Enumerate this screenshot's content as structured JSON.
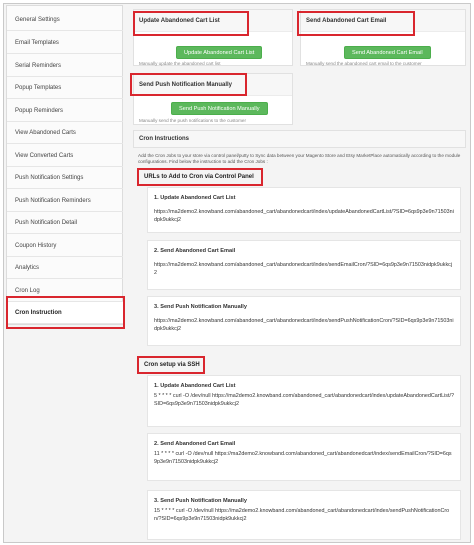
{
  "sidebar": {
    "items": [
      {
        "label": "General Settings"
      },
      {
        "label": "Email Templates"
      },
      {
        "label": "Serial Reminders"
      },
      {
        "label": "Popup Templates"
      },
      {
        "label": "Popup Reminders"
      },
      {
        "label": "View Abandoned Carts"
      },
      {
        "label": "View Converted Carts"
      },
      {
        "label": "Push Notification Settings"
      },
      {
        "label": "Push Notification Reminders"
      },
      {
        "label": "Push Notification Detail"
      },
      {
        "label": "Coupon History"
      },
      {
        "label": "Analytics"
      },
      {
        "label": "Cron Log"
      },
      {
        "label": "Cron Instruction"
      }
    ],
    "active_index": 13
  },
  "cards": {
    "update_cart": {
      "title": "Update Abandoned Cart List",
      "button": "Update Abandoned Cart List",
      "hint": "Manually update the abandoned cart list"
    },
    "send_email": {
      "title": "Send Abandoned Cart Email",
      "button": "Send Abandoned Cart Email",
      "hint": "Manually send the abandoned cart email to the customer"
    },
    "push": {
      "title": "Send Push Notification Manually",
      "button": "Send Push Notification Manually",
      "hint": "Manually send the push notifications to the customer"
    }
  },
  "instructions": {
    "title": "Cron Instructions",
    "text": "Add the Cron Jobs to your store via control panel/putty to Sync data between your Magento Store and Etsy MarketPlace automatically according to the module configurations. Find below the instruction to add the Cron Jobs :"
  },
  "urls_section": {
    "title": "URLs to Add to Cron via Control Panel",
    "items": [
      {
        "title": "1. Update Abandoned Cart List",
        "value": "https://ma2demo2.knowband.com/abandoned_cart/abandonedcart/index/updateAbandonedCartList/?SID=6qs9p3e9n71503nidpk9ukkcj2"
      },
      {
        "title": "2. Send Abandoned Cart Email",
        "value": "https://ma2demo2.knowband.com/abandoned_cart/abandonedcart/index/sendEmailCron/?SID=6qs9p3e9n71503nidpk9ukkcj2"
      },
      {
        "title": "3. Send Push Notification Manually",
        "value": "https://ma2demo2.knowband.com/abandoned_cart/abandonedcart/index/sendPushNotificationCron/?SID=6qs9p3e9n71503nidpk9ukkcj2"
      }
    ]
  },
  "ssh_section": {
    "title": "Cron setup via SSH",
    "items": [
      {
        "title": "1. Update Abandoned Cart List",
        "value": "5 * * * * curl -O /dev/null https://ma2demo2.knowband.com/abandoned_cart/abandonedcart/index/updateAbandonedCartList/?SID=6qs9p3e9n71503nidpk9ukkcj2"
      },
      {
        "title": "2. Send Abandoned Cart Email",
        "value": "11 * * * * curl -O /dev/null https://ma2demo2.knowband.com/abandoned_cart/abandonedcart/index/sendEmailCron/?SID=6qs9p3e9n71503nidpk9ukkcj2"
      },
      {
        "title": "3. Send Push Notification Manually",
        "value": "15 * * * * curl -O /dev/null https://ma2demo2.knowband.com/abandoned_cart/abandonedcart/index/sendPushNotificationCron/?SID=6qs9p3e9n71503nidpk9ukkcj2"
      }
    ]
  },
  "colors": {
    "highlight": "#d9262e",
    "button": "#5cb85c"
  }
}
